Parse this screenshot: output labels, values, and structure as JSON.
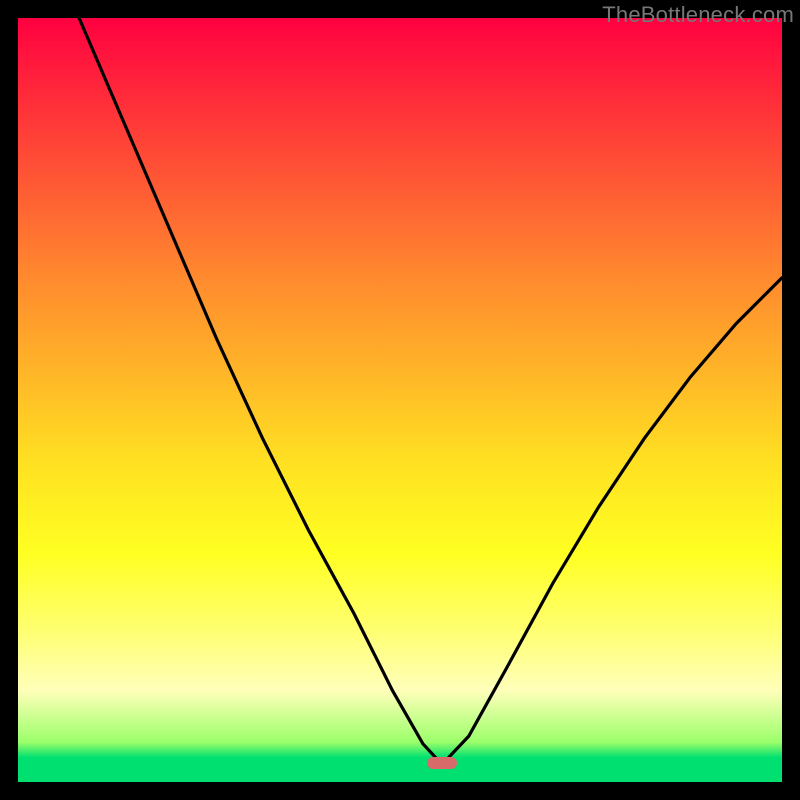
{
  "watermark": "TheBottleneck.com",
  "chart_data": {
    "type": "line",
    "title": "",
    "xlabel": "",
    "ylabel": "",
    "xlim": [
      0,
      100
    ],
    "ylim": [
      0,
      100
    ],
    "grid": false,
    "legend": false,
    "annotations": [
      {
        "name": "marker",
        "shape": "pill",
        "color": "#d86a6a",
        "x": 55.5,
        "y": 2.5
      }
    ],
    "series": [
      {
        "name": "left-branch",
        "points": [
          {
            "x": 8,
            "y": 100
          },
          {
            "x": 14,
            "y": 86
          },
          {
            "x": 20,
            "y": 72
          },
          {
            "x": 26,
            "y": 58
          },
          {
            "x": 32,
            "y": 45
          },
          {
            "x": 38,
            "y": 33
          },
          {
            "x": 44,
            "y": 22
          },
          {
            "x": 49,
            "y": 12
          },
          {
            "x": 53,
            "y": 5
          },
          {
            "x": 55.5,
            "y": 2.3
          }
        ]
      },
      {
        "name": "right-branch",
        "points": [
          {
            "x": 55.5,
            "y": 2.3
          },
          {
            "x": 59,
            "y": 6
          },
          {
            "x": 64,
            "y": 15
          },
          {
            "x": 70,
            "y": 26
          },
          {
            "x": 76,
            "y": 36
          },
          {
            "x": 82,
            "y": 45
          },
          {
            "x": 88,
            "y": 53
          },
          {
            "x": 94,
            "y": 60
          },
          {
            "x": 100,
            "y": 66
          }
        ]
      }
    ],
    "colors": {
      "curve": "#000000",
      "gradient_top": "#ff0040",
      "gradient_mid": "#ffff22",
      "gradient_bottom": "#00e070",
      "marker": "#d86a6a",
      "frame": "#000000"
    }
  }
}
